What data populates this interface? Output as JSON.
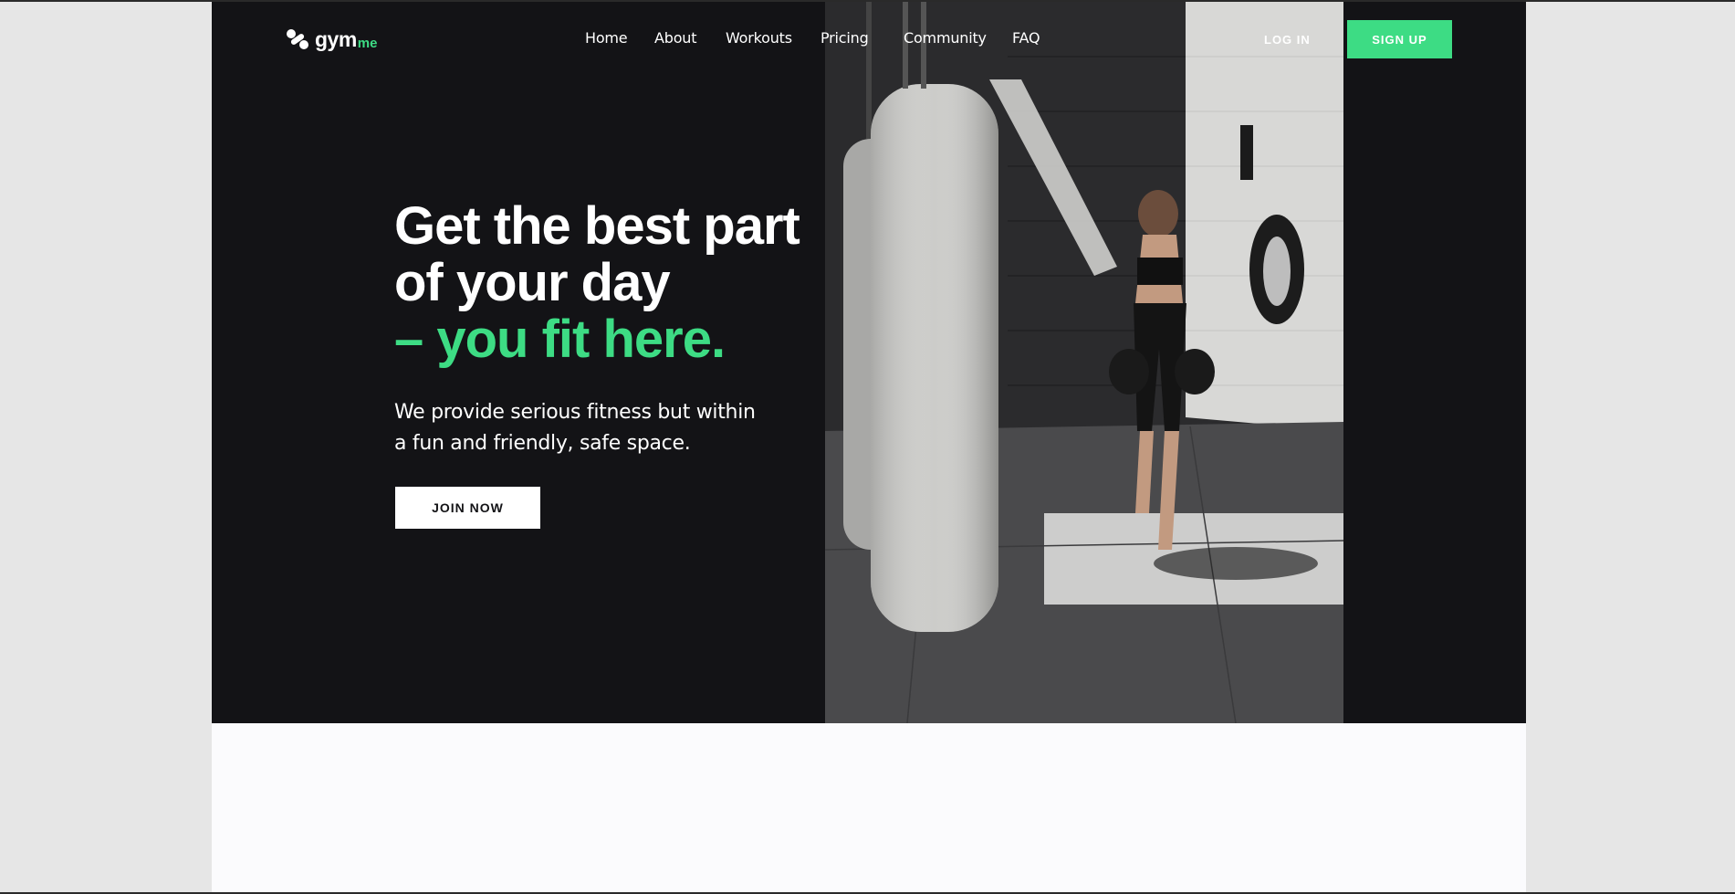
{
  "brand": {
    "name": "gym",
    "suffix": "me",
    "accent_color": "#3ddc84",
    "dark_color": "#131316"
  },
  "nav": {
    "items": [
      {
        "label": "Home"
      },
      {
        "label": "About"
      },
      {
        "label": "Workouts"
      },
      {
        "label": "Pricing"
      },
      {
        "label": "Community"
      },
      {
        "label": "FAQ"
      }
    ],
    "login_label": "LOG IN",
    "signup_label": "SIGN UP"
  },
  "hero": {
    "headline_line1": "Get the best part",
    "headline_line2": "of your day",
    "headline_accent": "– you fit here.",
    "subtext_line1": "We provide serious fitness but within",
    "subtext_line2": "a fun and friendly, safe space.",
    "cta_label": "JOIN NOW",
    "image_subject": "woman boxing beside hanging punching bags in gym"
  }
}
